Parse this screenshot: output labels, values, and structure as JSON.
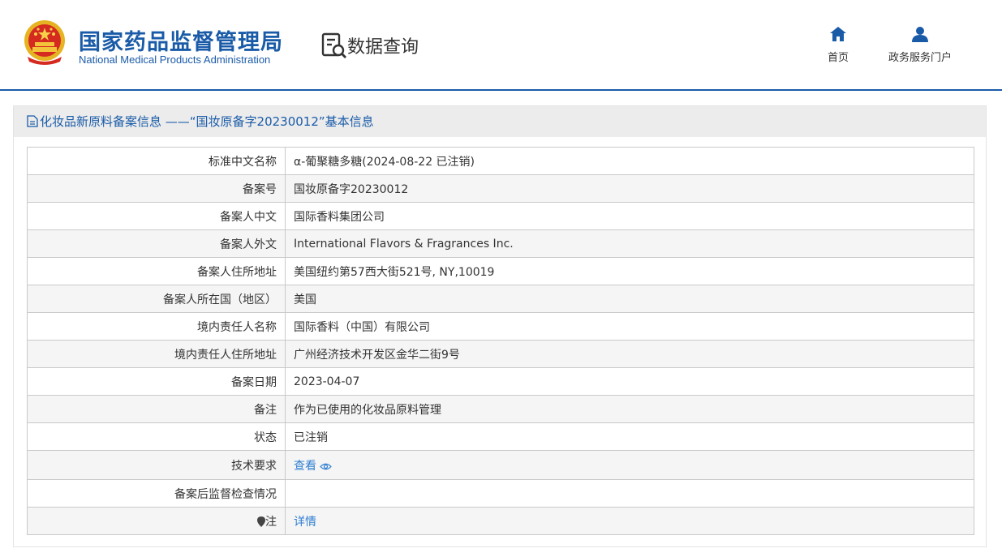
{
  "header": {
    "org_name_cn": "国家药品监督管理局",
    "org_name_en": "National Medical Products Administration",
    "page_title": "数据查询",
    "nav": [
      {
        "label": "首页",
        "icon": "home-icon"
      },
      {
        "label": "政务服务门户",
        "icon": "user-icon"
      }
    ],
    "accent_color": "#1a5ba8"
  },
  "panel": {
    "title": "化妆品新原料备案信息 ——“国妆原备字20230012”基本信息"
  },
  "details": {
    "rows": [
      {
        "label": "标准中文名称",
        "value": "α-葡聚糖多糖(2024-08-22 已注销)"
      },
      {
        "label": "备案号",
        "value": "国妆原备字20230012"
      },
      {
        "label": "备案人中文",
        "value": "国际香料集团公司"
      },
      {
        "label": "备案人外文",
        "value": "International Flavors & Fragrances Inc."
      },
      {
        "label": "备案人住所地址",
        "value": "美国纽约第57西大街521号, NY,10019"
      },
      {
        "label": "备案人所在国（地区）",
        "value": "美国"
      },
      {
        "label": "境内责任人名称",
        "value": "国际香料（中国）有限公司"
      },
      {
        "label": "境内责任人住所地址",
        "value": "广州经济技术开发区金华二街9号"
      },
      {
        "label": "备案日期",
        "value": "2023-04-07"
      },
      {
        "label": "备注",
        "value": "作为已使用的化妆品原料管理"
      },
      {
        "label": "状态",
        "value": "已注销"
      },
      {
        "label": "技术要求",
        "value": "查看"
      },
      {
        "label": "备案后监督检查情况",
        "value": ""
      },
      {
        "label": "注",
        "value": "详情"
      }
    ]
  }
}
